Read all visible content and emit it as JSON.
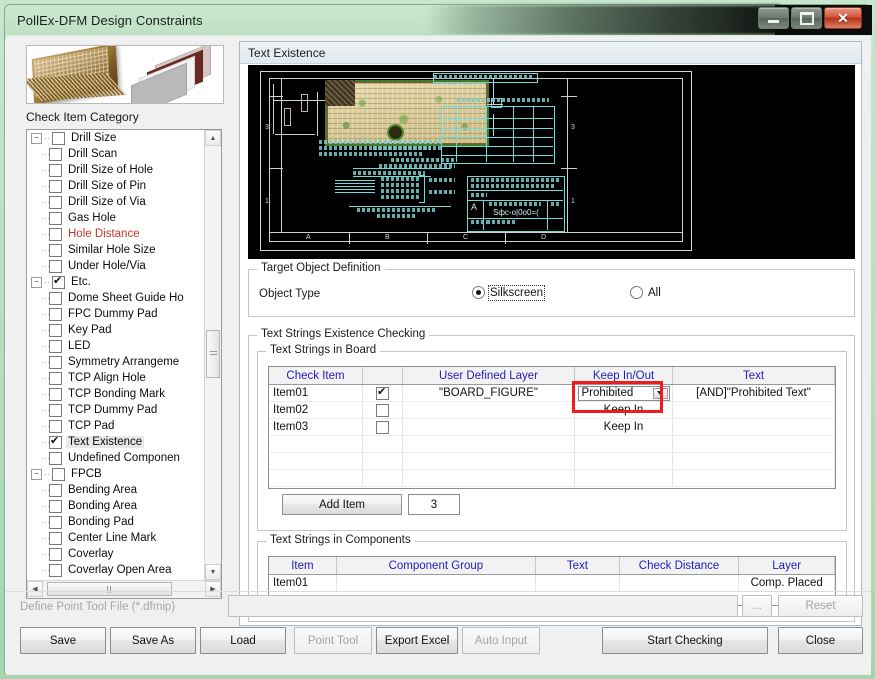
{
  "window": {
    "title": "PollEx-DFM Design Constraints",
    "minimize_label": "Minimize",
    "maximize_label": "Maximize",
    "close_label": "✕"
  },
  "left": {
    "thumbnail_name": "pcb-chip-photo",
    "category_label": "Check Item Category",
    "tree": [
      {
        "label": "Drill Size",
        "level": 0,
        "expander": "−",
        "checked": false,
        "color": "normal"
      },
      {
        "label": "Drill Scan",
        "level": 1,
        "checked": false,
        "color": "normal"
      },
      {
        "label": "Drill Size of Hole",
        "level": 1,
        "checked": false,
        "color": "normal"
      },
      {
        "label": "Drill Size of Pin",
        "level": 1,
        "checked": false,
        "color": "normal"
      },
      {
        "label": "Drill Size of Via",
        "level": 1,
        "checked": false,
        "color": "normal"
      },
      {
        "label": "Gas Hole",
        "level": 1,
        "checked": false,
        "color": "normal"
      },
      {
        "label": "Hole Distance",
        "level": 1,
        "checked": false,
        "color": "red"
      },
      {
        "label": "Similar Hole Size",
        "level": 1,
        "checked": false,
        "color": "normal"
      },
      {
        "label": "Under Hole/Via",
        "level": 1,
        "checked": false,
        "color": "normal"
      },
      {
        "label": "Etc.",
        "level": 0,
        "expander": "−",
        "checked": true,
        "color": "normal"
      },
      {
        "label": "Dome Sheet Guide Ho",
        "level": 1,
        "checked": false,
        "color": "normal"
      },
      {
        "label": "FPC Dummy Pad",
        "level": 1,
        "checked": false,
        "color": "normal"
      },
      {
        "label": "Key Pad",
        "level": 1,
        "checked": false,
        "color": "normal"
      },
      {
        "label": "LED",
        "level": 1,
        "checked": false,
        "color": "normal"
      },
      {
        "label": "Symmetry Arrangeme",
        "level": 1,
        "checked": false,
        "color": "normal"
      },
      {
        "label": "TCP Align Hole",
        "level": 1,
        "checked": false,
        "color": "normal"
      },
      {
        "label": "TCP Bonding Mark",
        "level": 1,
        "checked": false,
        "color": "normal"
      },
      {
        "label": "TCP Dummy Pad",
        "level": 1,
        "checked": false,
        "color": "normal"
      },
      {
        "label": "TCP Pad",
        "level": 1,
        "checked": false,
        "color": "normal"
      },
      {
        "label": "Text Existence",
        "level": 1,
        "checked": true,
        "color": "normal",
        "selected": true
      },
      {
        "label": "Undefined Componen",
        "level": 1,
        "checked": false,
        "color": "normal"
      },
      {
        "label": "FPCB",
        "level": 0,
        "expander": "−",
        "checked": false,
        "color": "normal"
      },
      {
        "label": "Bending Area",
        "level": 1,
        "checked": false,
        "color": "normal"
      },
      {
        "label": "Bonding Area",
        "level": 1,
        "checked": false,
        "color": "normal"
      },
      {
        "label": "Bonding Pad",
        "level": 1,
        "checked": false,
        "color": "normal"
      },
      {
        "label": "Center Line Mark",
        "level": 1,
        "checked": false,
        "color": "normal"
      },
      {
        "label": "Coverlay",
        "level": 1,
        "checked": false,
        "color": "normal"
      },
      {
        "label": "Coverlay Open Area",
        "level": 1,
        "checked": false,
        "color": "normal"
      }
    ]
  },
  "right": {
    "header_title": "Text Existence",
    "preview_name": "cad-drawing-preview",
    "target_object": {
      "legend": "Target Object Definition",
      "object_type_label": "Object Type",
      "options": [
        {
          "label": "Silkscreen",
          "selected": true
        },
        {
          "label": "All",
          "selected": false
        }
      ]
    },
    "text_checking": {
      "legend": "Text Strings Existence Checking",
      "board": {
        "legend": "Text Strings in Board",
        "columns": [
          "Check Item",
          "",
          "User Defined Layer",
          "Keep In/Out",
          "Text"
        ],
        "rows": [
          {
            "item": "Item01",
            "checked": true,
            "layer": "\"BOARD_FIGURE\"",
            "keep": "Prohibited",
            "keep_is_combo": true,
            "text": "[AND]\"Prohibited Text\""
          },
          {
            "item": "Item02",
            "checked": false,
            "layer": "",
            "keep": "Keep In",
            "keep_is_combo": false,
            "text": ""
          },
          {
            "item": "Item03",
            "checked": false,
            "layer": "",
            "keep": "Keep In",
            "keep_is_combo": false,
            "text": ""
          }
        ],
        "add_item_label": "Add Item",
        "item_count": "3",
        "highlight_color": "#ee1c1c"
      },
      "components": {
        "legend": "Text Strings in Components",
        "columns": [
          "Item",
          "Component Group",
          "Text",
          "Check Distance",
          "Layer"
        ],
        "rows": [
          {
            "item": "Item01",
            "group": "",
            "text": "",
            "distance": "",
            "layer": "Comp. Placed"
          }
        ]
      }
    }
  },
  "bottom": {
    "path_label": "Define Point Tool File (*.dfmip)",
    "path_value": "",
    "browse_label": "...",
    "reset_label": "Reset",
    "buttons": [
      {
        "label": "Save",
        "enabled": true
      },
      {
        "label": "Save As",
        "enabled": true
      },
      {
        "label": "Load",
        "enabled": true
      },
      {
        "label": "Point Tool",
        "enabled": false
      },
      {
        "label": "Export Excel",
        "enabled": true
      },
      {
        "label": "Auto Input",
        "enabled": false
      },
      {
        "label": "Start Checking",
        "enabled": true
      },
      {
        "label": "Close",
        "enabled": true
      }
    ]
  }
}
